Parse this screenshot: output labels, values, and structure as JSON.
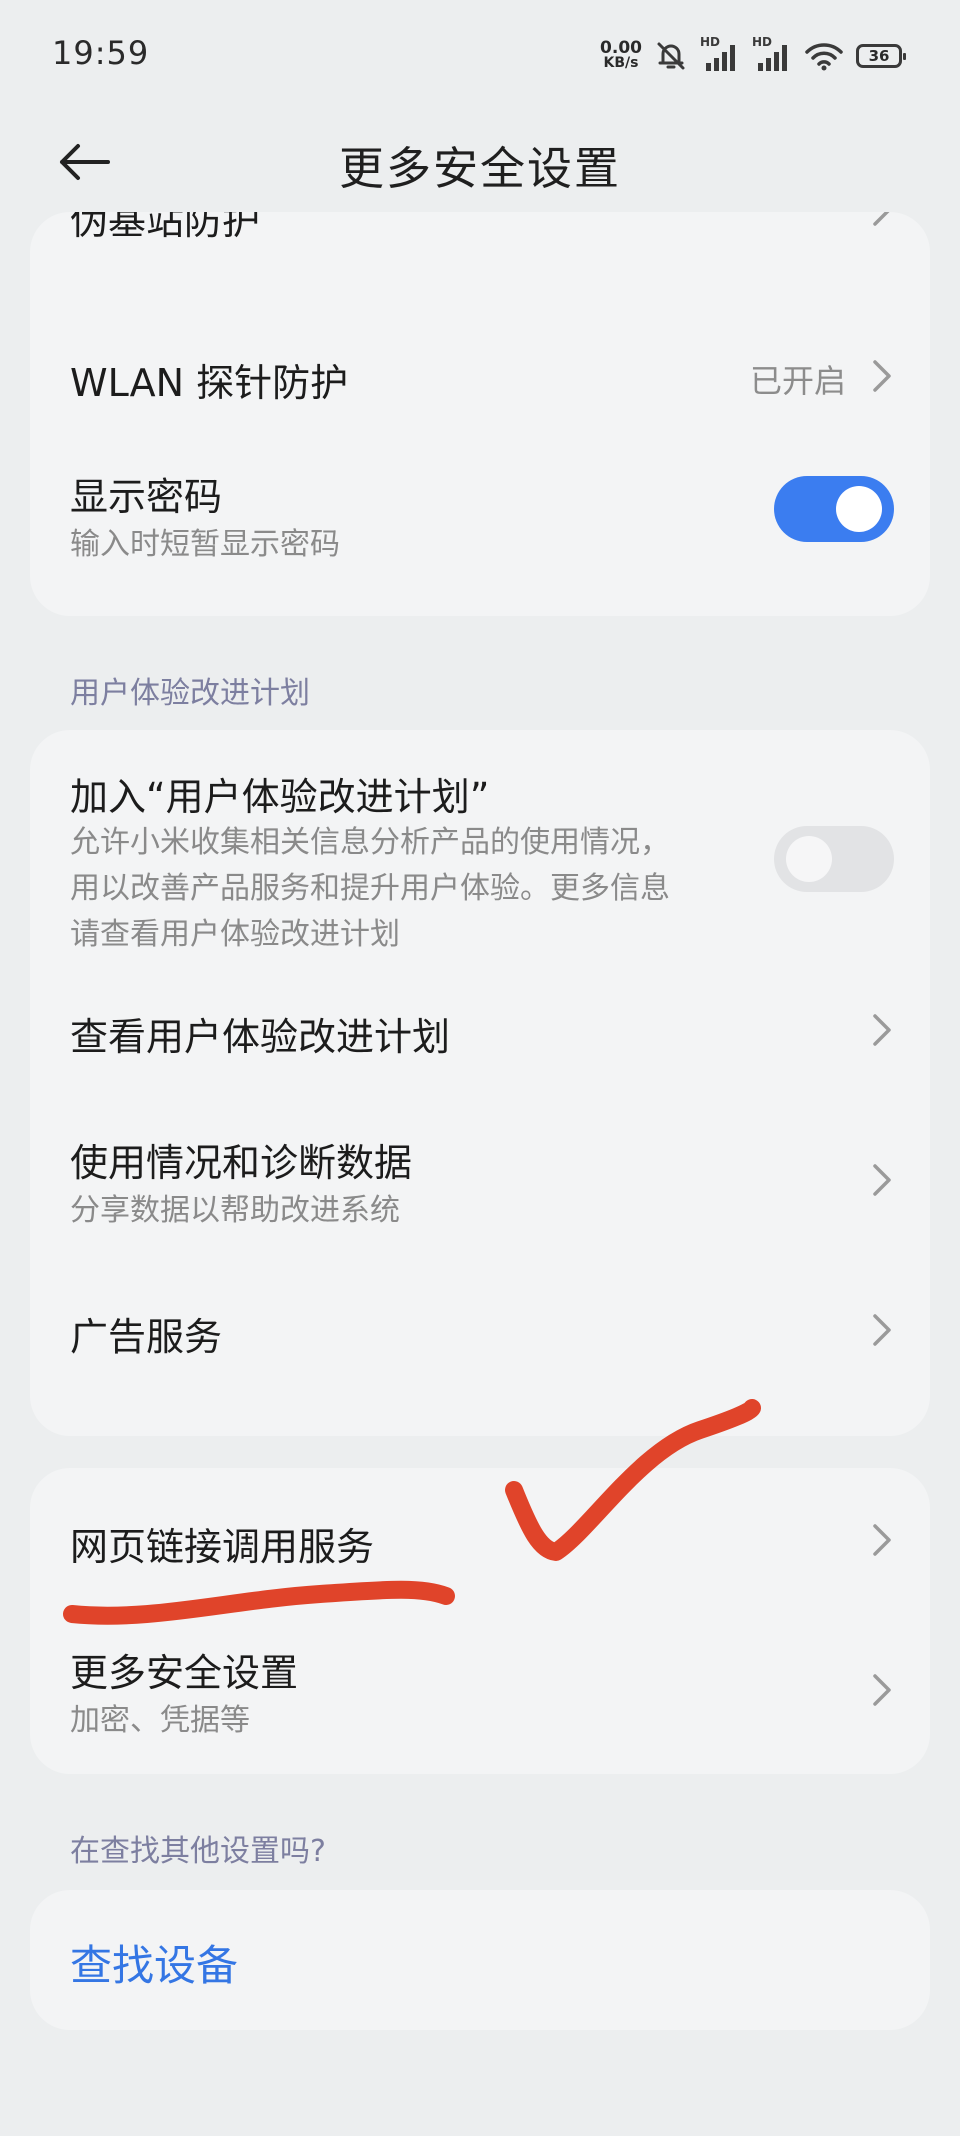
{
  "status_bar": {
    "time": "19:59",
    "net_speed_value": "0.00",
    "net_speed_unit": "KB/s",
    "signal1_label": "HD",
    "signal2_label": "HD",
    "battery": "36",
    "icons": [
      "mute-bell-icon",
      "signal-icon",
      "signal-icon",
      "wifi-icon",
      "battery-icon"
    ]
  },
  "header": {
    "title": "更多安全设置",
    "back_icon": "back-arrow-icon"
  },
  "card1": {
    "items": [
      {
        "title": "伪基站防护"
      },
      {
        "title": "WLAN 探针防护",
        "value": "已开启"
      },
      {
        "title": "显示密码",
        "subtitle": "输入时短暂显示密码",
        "toggle": true
      }
    ]
  },
  "section_ux": {
    "label": "用户体验改进计划"
  },
  "card2": {
    "items": [
      {
        "title": "加入“用户体验改进计划”",
        "subtitle_lines": [
          "允许小米收集相关信息分析产品的使用情况，",
          "用以改善产品服务和提升用户体验。更多信息",
          "请查看用户体验改进计划"
        ],
        "toggle": false
      },
      {
        "title": "查看用户体验改进计划"
      },
      {
        "title": "使用情况和诊断数据",
        "subtitle": "分享数据以帮助改进系统"
      },
      {
        "title": "广告服务"
      }
    ]
  },
  "card3": {
    "items": [
      {
        "title": "网页链接调用服务"
      },
      {
        "title": "更多安全设置",
        "subtitle": "加密、凭据等"
      }
    ]
  },
  "section_search": {
    "label": "在查找其他设置吗?"
  },
  "card4": {
    "find_device": "查找设备"
  },
  "colors": {
    "background": "#eceeef",
    "card": "#f3f4f5",
    "accent": "#3b7df0",
    "link": "#3476e4",
    "annotation": "#e0442a"
  }
}
